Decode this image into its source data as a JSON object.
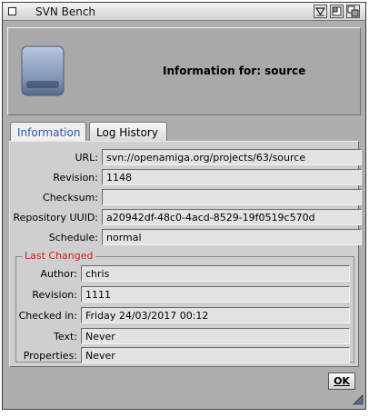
{
  "window": {
    "title": "SVN Bench"
  },
  "header": {
    "title": "Information for: source"
  },
  "tabs": [
    {
      "label": "Information",
      "active": true
    },
    {
      "label": "Log History",
      "active": false
    }
  ],
  "info": {
    "url_label": "URL:",
    "url_value": "svn://openamiga.org/projects/63/source",
    "revision_label": "Revision:",
    "revision_value": "1148",
    "checksum_label": "Checksum:",
    "checksum_value": "",
    "uuid_label": "Repository UUID:",
    "uuid_value": "a20942df-48c0-4acd-8529-19f0519c570d",
    "schedule_label": "Schedule:",
    "schedule_value": "normal"
  },
  "last_changed": {
    "title": "Last Changed",
    "author_label": "Author:",
    "author_value": "chris",
    "revision_label": "Revision:",
    "revision_value": "1111",
    "checked_label": "Checked in:",
    "checked_value": "Friday 24/03/2017 00:12",
    "text_label": "Text:",
    "text_value": "Never",
    "properties_label": "Properties:",
    "properties_value": "Never"
  },
  "buttons": {
    "ok_label": "OK"
  },
  "colors": {
    "accent_tab": "#2c5bb5",
    "group_title": "#cc2222"
  }
}
